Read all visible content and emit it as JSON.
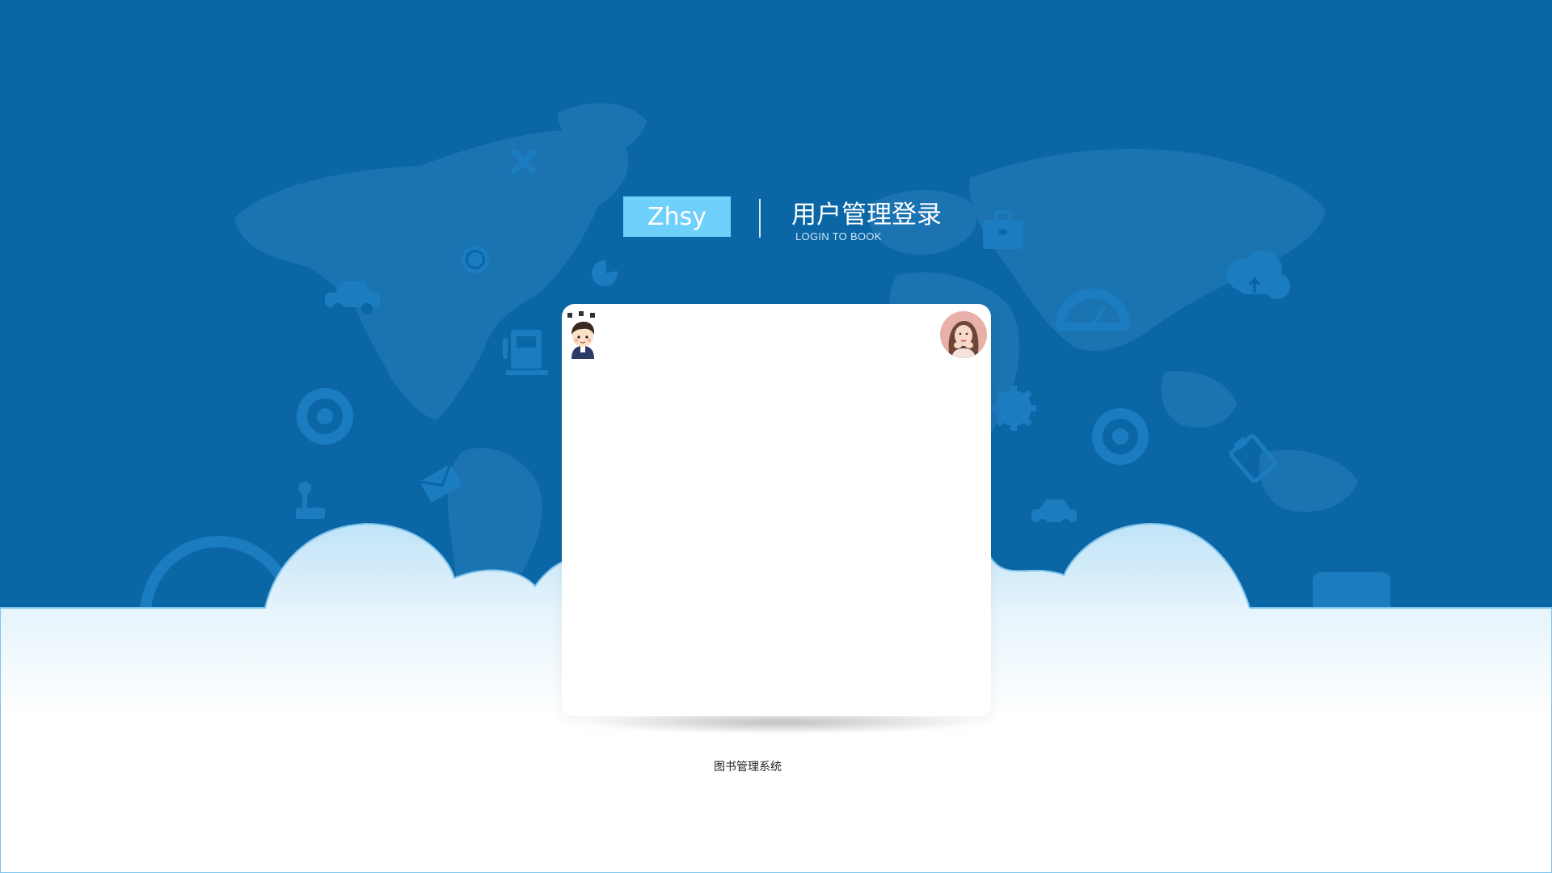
{
  "header": {
    "brand": "Zhsy",
    "title": "用户管理登录",
    "subtitle": "LOGIN TO BOOK"
  },
  "card": {
    "left_avatar_icon": "cartoon-boy-avatar-icon",
    "right_avatar_icon": "girl-photo-avatar-icon"
  },
  "background_icons": [
    "tools-icon",
    "globe-icon",
    "car-icon",
    "pie-chart-icon",
    "fuel-pump-icon",
    "wheel-icon",
    "envelope-icon",
    "gear-shift-icon",
    "briefcase-icon",
    "cloud-upload-icon",
    "speedometer-icon",
    "gear-icon",
    "clipboard-icon"
  ],
  "footer": {
    "text": "图书管理系统"
  },
  "colors": {
    "sky": "#0b66a6",
    "brand_box": "#6fd0fb",
    "card": "#ffffff",
    "cloud_edge": "#7fc4ec"
  }
}
